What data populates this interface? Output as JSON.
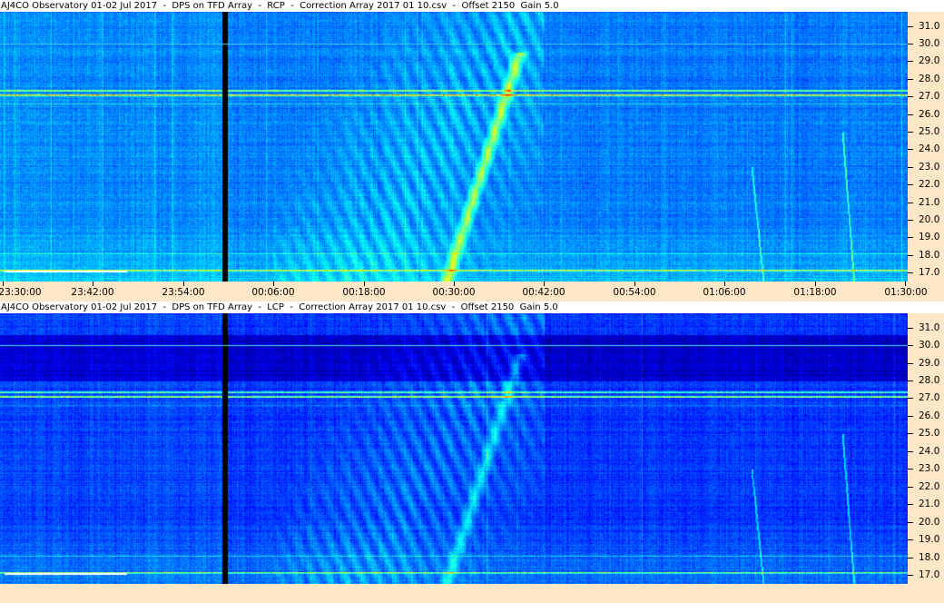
{
  "panels": [
    {
      "title": "AJ4CO Observatory 01-02 Jul 2017  -  DPS on TFD Array  -  RCP  -  Correction Array 2017 01 10.csv  -  Offset 2150  Gain 5.0"
    },
    {
      "title": "AJ4CO Observatory 01-02 Jul 2017  -  DPS on TFD Array  -  LCP  -  Correction Array 2017 01 10.csv  -  Offset 2150  Gain 5.0"
    }
  ],
  "chart_data": {
    "type": "heatmap",
    "x_ticks": [
      "23:30:00",
      "23:42:00",
      "23:54:00",
      "00:06:00",
      "00:18:00",
      "00:30:00",
      "00:42:00",
      "00:54:00",
      "01:06:00",
      "01:18:00",
      "01:30:00"
    ],
    "xlim": [
      "23:30:00",
      "01:30:00"
    ],
    "y_ticks": [
      "31.0",
      "30.0",
      "29.0",
      "28.0",
      "27.0",
      "26.0",
      "25.0",
      "24.0",
      "23.0",
      "22.0",
      "21.0",
      "20.0",
      "19.0",
      "18.0",
      "17.0"
    ],
    "ylim": [
      16.5,
      31.8
    ],
    "ylabel": "",
    "xlabel": "",
    "colormap": [
      "#00007f",
      "#0000ff",
      "#007fff",
      "#00ffff",
      "#7fff7f",
      "#ffff00",
      "#ff7f00",
      "#ff0000"
    ],
    "series": [
      {
        "name": "RCP"
      },
      {
        "name": "LCP"
      }
    ]
  },
  "colors": {
    "axis_background": "#fde7c6",
    "title_background": "#ffffff"
  }
}
